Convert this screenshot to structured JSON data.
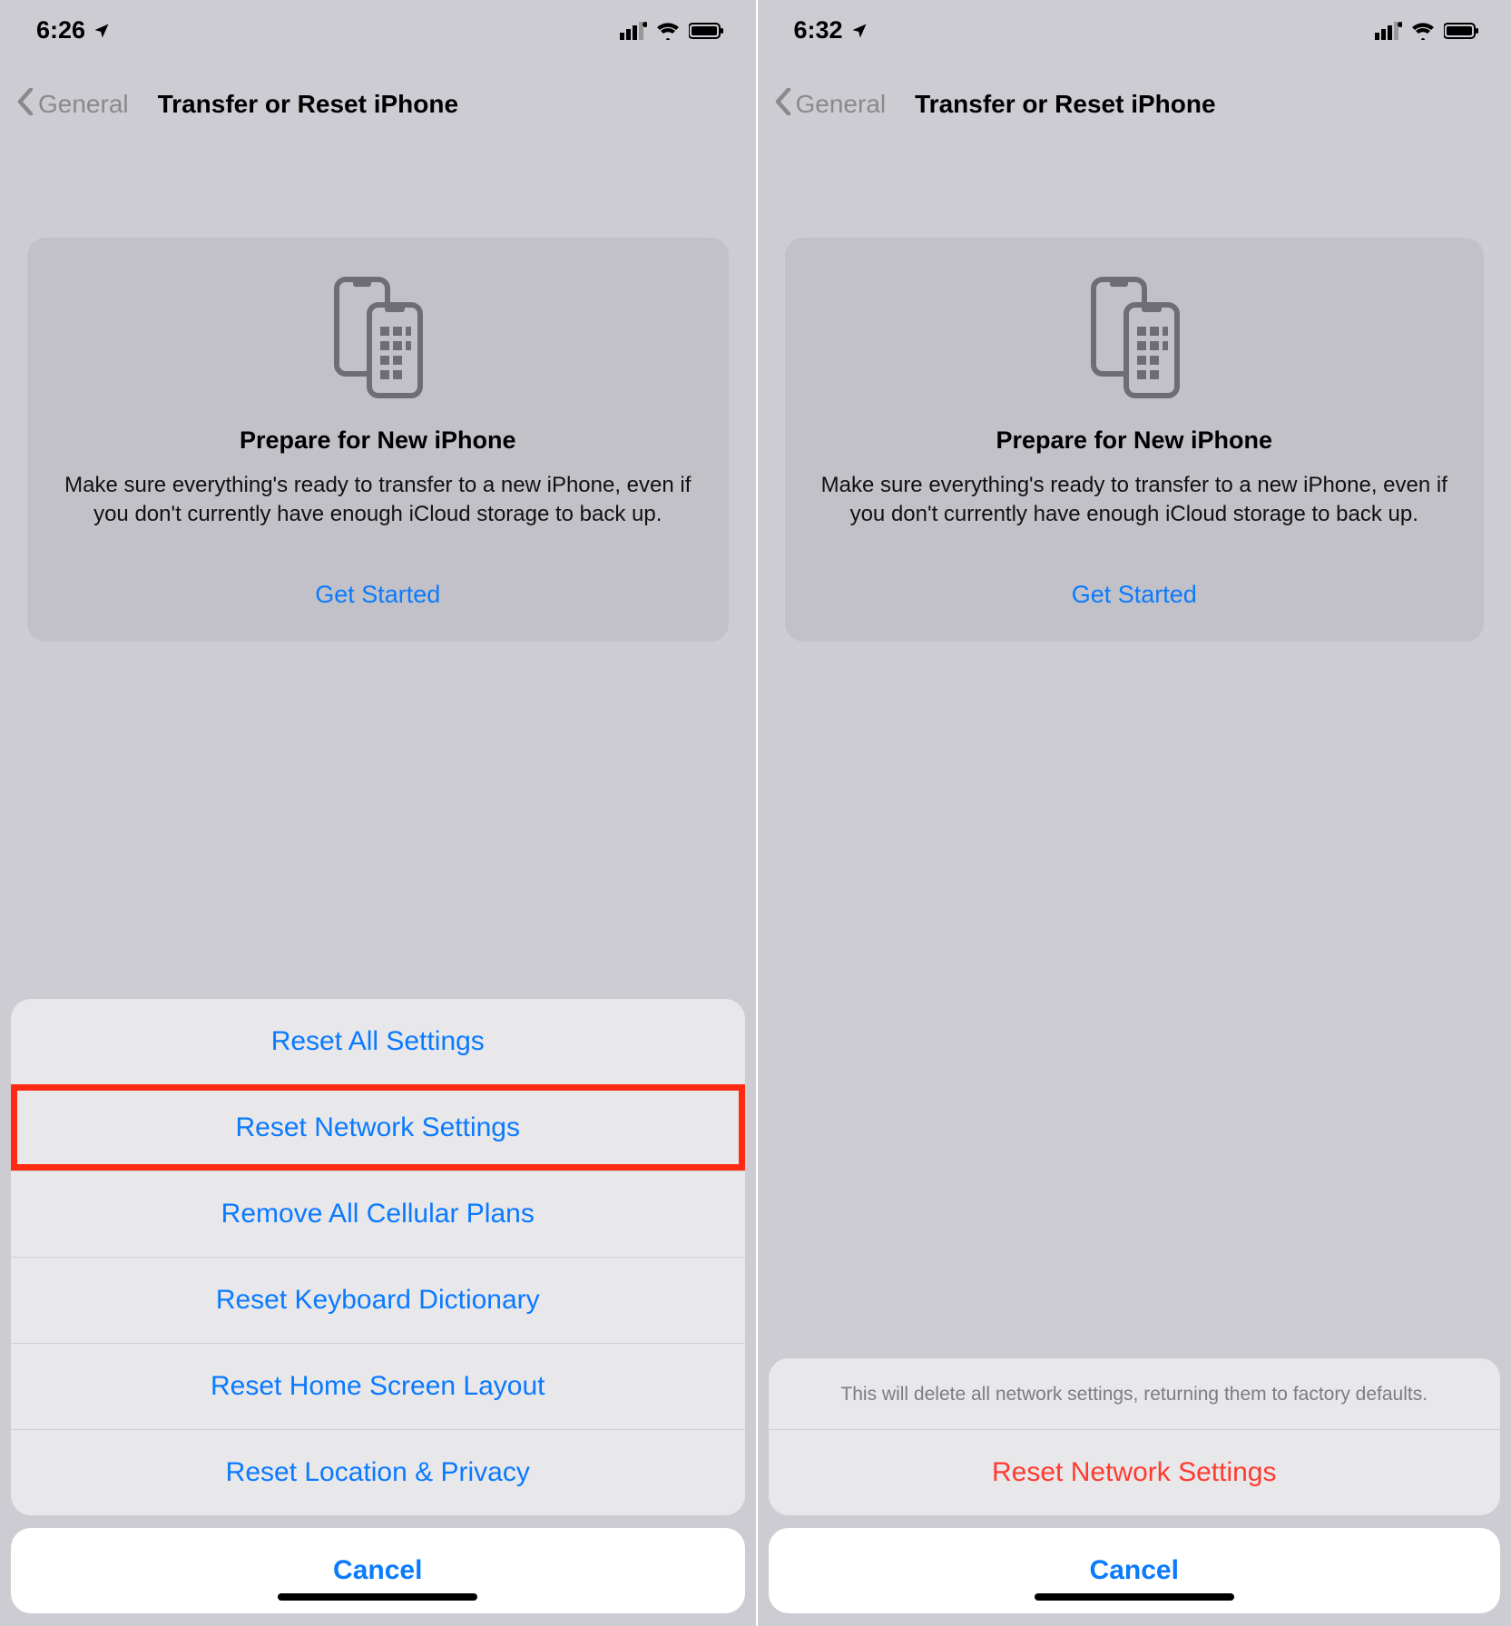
{
  "left": {
    "status": {
      "time": "6:26"
    },
    "nav": {
      "back": "General",
      "title": "Transfer or Reset iPhone"
    },
    "prepare": {
      "title": "Prepare for New iPhone",
      "desc": "Make sure everything's ready to transfer to a new iPhone, even if you don't currently have enough iCloud storage to back up.",
      "cta": "Get Started"
    },
    "sheet": {
      "items": [
        "Reset All Settings",
        "Reset Network Settings",
        "Remove All Cellular Plans",
        "Reset Keyboard Dictionary",
        "Reset Home Screen Layout",
        "Reset Location & Privacy"
      ],
      "highlighted_index": 1,
      "cancel": "Cancel"
    }
  },
  "right": {
    "status": {
      "time": "6:32"
    },
    "nav": {
      "back": "General",
      "title": "Transfer or Reset iPhone"
    },
    "prepare": {
      "title": "Prepare for New iPhone",
      "desc": "Make sure everything's ready to transfer to a new iPhone, even if you don't currently have enough iCloud storage to back up.",
      "cta": "Get Started"
    },
    "sheet": {
      "message": "This will delete all network settings, returning them to factory defaults.",
      "confirm": "Reset Network Settings",
      "cancel": "Cancel"
    }
  }
}
